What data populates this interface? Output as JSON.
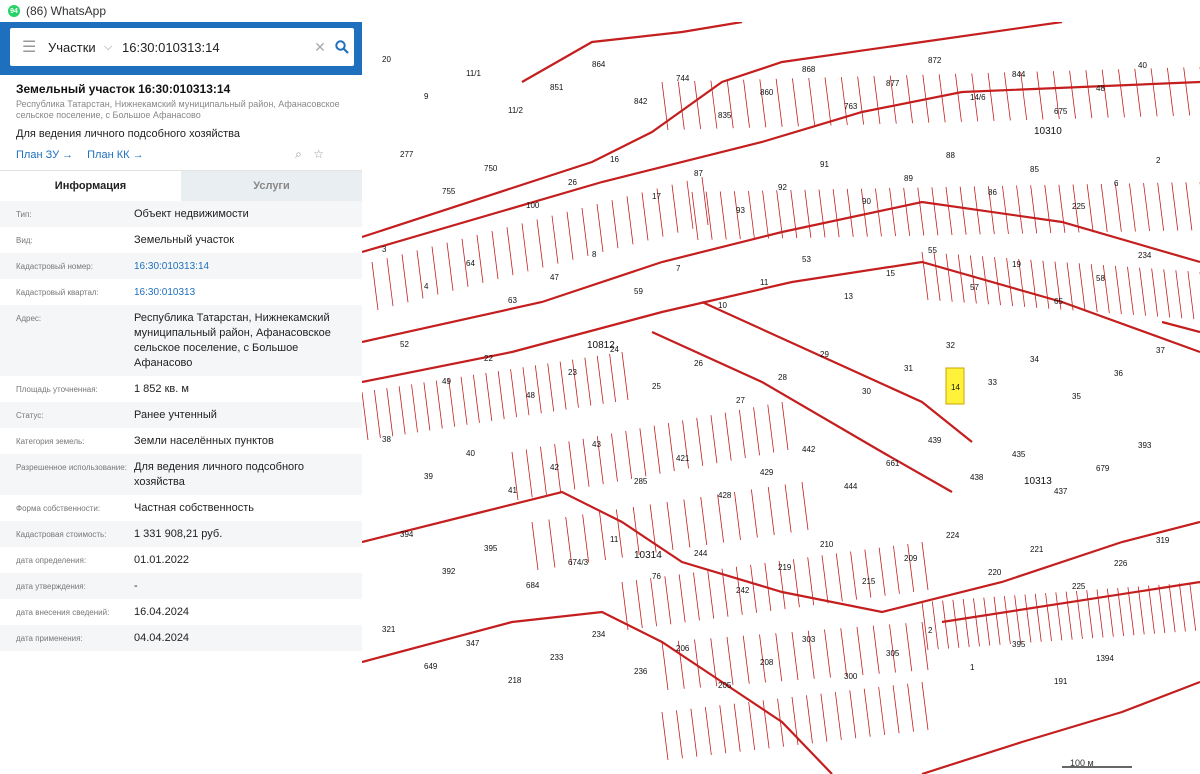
{
  "window": {
    "title": "(86) WhatsApp",
    "icon": "whatsapp-icon",
    "icon_badge": "94"
  },
  "search": {
    "layer": "Участки",
    "query": "16:30:010313:14"
  },
  "object": {
    "title": "Земельный участок 16:30:010313:14",
    "address_short": "Республика Татарстан, Нижнекамский муниципальный район, Афанасовское сельское поселение, с Большое Афанасово",
    "use": "Для ведения личного подсобного хозяйства",
    "plan_zu": "План ЗУ →",
    "plan_kk": "План КК →"
  },
  "tabs": {
    "info": "Информация",
    "services": "Услуги"
  },
  "rows": [
    {
      "label": "Тип:",
      "value": "Объект недвижимости"
    },
    {
      "label": "Вид:",
      "value": "Земельный участок"
    },
    {
      "label": "Кадастровый номер:",
      "value": "16:30:010313:14"
    },
    {
      "label": "Кадастровый квартал:",
      "value": "16:30:010313"
    },
    {
      "label": "Адрес:",
      "value": "Республика Татарстан, Нижнекамский муниципальный район, Афанасовское сельское поселение, с Большое Афанасово"
    },
    {
      "label": "Площадь уточненная:",
      "value": "1 852 кв. м"
    },
    {
      "label": "Статус:",
      "value": "Ранее учтенный"
    },
    {
      "label": "Категория земель:",
      "value": "Земли населённых пунктов"
    },
    {
      "label": "Разрешенное использование:",
      "value": "Для ведения личного подсобного хозяйства"
    },
    {
      "label": "Форма собственности:",
      "value": "Частная собственность"
    },
    {
      "label": "Кадастровая стоимость:",
      "value": "1 331 908,21 руб."
    },
    {
      "label": "дата определения:",
      "value": "01.01.2022"
    },
    {
      "label": "дата утверждения:",
      "value": "-"
    },
    {
      "label": "дата внесения сведений:",
      "value": "16.04.2024"
    },
    {
      "label": "дата применения:",
      "value": "04.04.2024"
    }
  ],
  "map": {
    "quarters": [
      "10812",
      "10313",
      "10314",
      "10310"
    ],
    "parcel_labels": [
      "20",
      "9",
      "11/1",
      "11/2",
      "851",
      "864",
      "842",
      "744",
      "835",
      "860",
      "868",
      "763",
      "877",
      "872",
      "14/6",
      "844",
      "675",
      "48",
      "40",
      "277",
      "755",
      "750",
      "100",
      "26",
      "16",
      "17",
      "87",
      "93",
      "92",
      "91",
      "90",
      "89",
      "88",
      "86",
      "85",
      "225",
      "6",
      "2",
      "3",
      "4",
      "64",
      "63",
      "47",
      "8",
      "59",
      "7",
      "10",
      "11",
      "53",
      "13",
      "15",
      "55",
      "57",
      "19",
      "65",
      "58",
      "234",
      "52",
      "49",
      "22",
      "48",
      "23",
      "24",
      "25",
      "26",
      "27",
      "28",
      "29",
      "30",
      "31",
      "32",
      "33",
      "34",
      "35",
      "36",
      "37",
      "38",
      "39",
      "40",
      "41",
      "42",
      "43",
      "285",
      "421",
      "428",
      "429",
      "442",
      "444",
      "661",
      "439",
      "438",
      "435",
      "437",
      "679",
      "393",
      "394",
      "392",
      "395",
      "684",
      "674/3",
      "11",
      "76",
      "244",
      "242",
      "219",
      "210",
      "215",
      "209",
      "224",
      "220",
      "221",
      "225",
      "226",
      "319",
      "321",
      "649",
      "347",
      "218",
      "233",
      "234",
      "236",
      "206",
      "205",
      "208",
      "303",
      "300",
      "305",
      "2",
      "1",
      "395",
      "191",
      "1394"
    ],
    "highlight_label": "14",
    "scale_label": "100 м",
    "line_color": "#c41e1e",
    "highlight_color": "#fff23a"
  }
}
